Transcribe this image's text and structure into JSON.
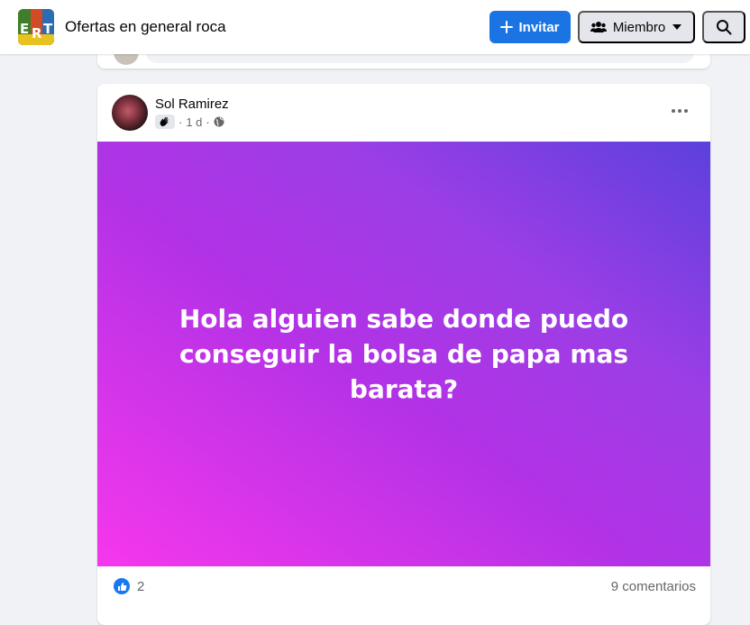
{
  "header": {
    "group_name": "Ofertas en general roca",
    "invite_label": "Invitar",
    "member_label": "Miembro",
    "logo_letters": [
      "E",
      "R",
      "T"
    ]
  },
  "post": {
    "author": "Sol Ramirez",
    "separator": "·",
    "time": "1 d",
    "text": "Hola alguien sabe donde puedo conseguir la bolsa de papa mas barata?",
    "reaction_count": "2",
    "comments_label": "9 comentarios"
  },
  "colors": {
    "primary": "#1b74e4",
    "gradient_start": "#f637ec",
    "gradient_end": "#5c40dc"
  },
  "icons": [
    "plus-icon",
    "people-icon",
    "caret-down-icon",
    "search-icon",
    "wave-badge-icon",
    "globe-icon",
    "more-icon",
    "like-icon"
  ]
}
